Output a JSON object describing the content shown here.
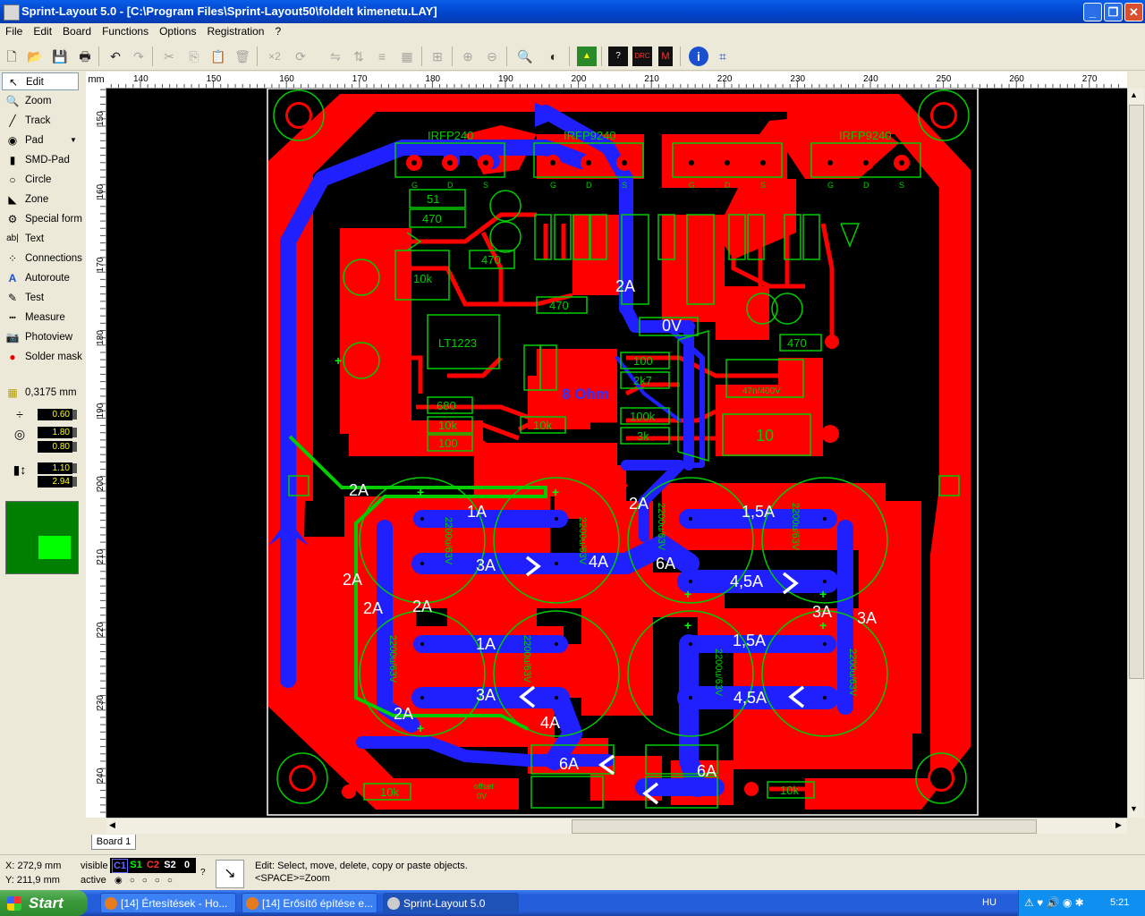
{
  "window": {
    "title": "Sprint-Layout 5.0 - [C:\\Program Files\\Sprint-Layout50\\foldelt kimenetu.LAY]",
    "minimize": "_",
    "maximize": "❐",
    "close": "✕"
  },
  "menu": [
    "File",
    "Edit",
    "Board",
    "Functions",
    "Options",
    "Registration",
    "?"
  ],
  "toolbar": {
    "x2_label": "×2"
  },
  "tools": [
    {
      "label": "Edit",
      "icon": "arrow-icon"
    },
    {
      "label": "Zoom",
      "icon": "zoom-icon"
    },
    {
      "label": "Track",
      "icon": "track-icon"
    },
    {
      "label": "Pad",
      "icon": "pad-icon"
    },
    {
      "label": "SMD-Pad",
      "icon": "smd-pad-icon"
    },
    {
      "label": "Circle",
      "icon": "circle-icon"
    },
    {
      "label": "Zone",
      "icon": "zone-icon"
    },
    {
      "label": "Special form",
      "icon": "special-form-icon"
    },
    {
      "label": "Text",
      "icon": "text-icon"
    },
    {
      "label": "Connections",
      "icon": "connections-icon"
    },
    {
      "label": "Autoroute",
      "icon": "autoroute-icon"
    },
    {
      "label": "Test",
      "icon": "test-icon"
    },
    {
      "label": "Measure",
      "icon": "measure-icon"
    },
    {
      "label": "Photoview",
      "icon": "photoview-icon"
    },
    {
      "label": "Solder mask",
      "icon": "solder-mask-icon"
    }
  ],
  "grid": "0,3175 mm",
  "params": {
    "track_width": "0.60",
    "pad_outer": "1.80",
    "pad_inner": "0.80",
    "smd_w": "1.10",
    "smd_h": "2.94"
  },
  "colors": {
    "canvas": "#000000",
    "copper_top": "#ff0000",
    "copper_bottom": "#3030ff",
    "silkscreen": "#00cc00"
  },
  "ruler": {
    "unit": "mm",
    "top_ticks": [
      "140",
      "150",
      "160",
      "170",
      "180",
      "190",
      "200",
      "210",
      "220",
      "230",
      "240",
      "250",
      "260",
      "270"
    ],
    "left_ticks": [
      "150",
      "160",
      "170",
      "180",
      "190",
      "200",
      "210",
      "220",
      "230",
      "240"
    ]
  },
  "board": {
    "labels": {
      "irfp240": "IRFP240",
      "irfp9240_a": "IRFP9240",
      "irfp9240_b": "IRFP9240",
      "r51": "51",
      "r470": "470",
      "r470b": "470",
      "r470c": "470",
      "r470d": "470",
      "r10k": "10k",
      "r680": "680",
      "r10k_b": "10k",
      "r100": "100",
      "r10k_c": "10k",
      "r100_b": "100",
      "r2k7": "2k7",
      "r100k": "100k",
      "r3k": "3k",
      "r10k_d": "10k",
      "r10k_e": "10k",
      "cap47n": "47n/400V",
      "r10_big": "10",
      "lt1223": "LT1223",
      "zero_v": "0V",
      "eight_ohm": "8 Ohm",
      "offset": "offset",
      "offset_0v": "0V",
      "cap_label": "2200u/63V"
    },
    "currents": {
      "c2a_top": "2A",
      "c2a_left1": "2A",
      "c2a_left2": "2A",
      "c2a_left3": "2A",
      "c2a_left4": "2A",
      "c2a_bottom": "2A",
      "c2a_mid": "2A",
      "c1a_a": "1A",
      "c1a_b": "1A",
      "c3a_a": "3A",
      "c3a_b": "3A",
      "c3a_c": "3A",
      "c3a_d": "3A",
      "c4a_a": "4A",
      "c4a_b": "4A",
      "c6a_a": "6A",
      "c6a_b": "6A",
      "c6a_c": "6A",
      "c15a_a": "1,5A",
      "c15a_b": "1,5A",
      "c45a_a": "4,5A",
      "c45a_b": "4,5A",
      "c2a_fuse": "2A"
    },
    "pin_labels": [
      "G",
      "D",
      "S"
    ]
  },
  "tabs": [
    "Board 1"
  ],
  "status": {
    "x": "X:   272,9 mm",
    "y": "Y:   211,9 mm",
    "visible_label": "visible",
    "active_label": "active",
    "layers": [
      "C1",
      "S1",
      "C2",
      "S2",
      "0"
    ],
    "help_line1": "Edit: Select, move, delete, copy or paste objects.",
    "help_line2": "<SPACE>=Zoom"
  },
  "taskbar": {
    "start": "Start",
    "items": [
      {
        "label": "[14] Értesítések - Ho..."
      },
      {
        "label": "[14] Erősítő építése e..."
      },
      {
        "label": "Sprint-Layout 5.0"
      }
    ],
    "language": "HU",
    "clock": "5:21"
  }
}
